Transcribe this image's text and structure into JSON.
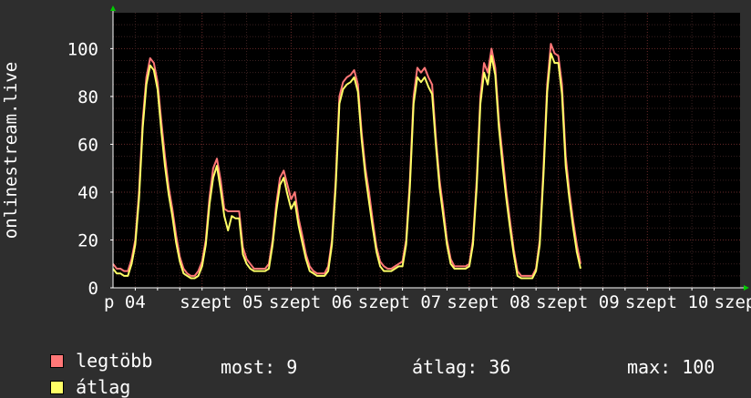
{
  "chart_data": {
    "type": "line",
    "ylabel": "onlinestream.live",
    "ylim": [
      0,
      115
    ],
    "y_ticks": [
      0,
      20,
      40,
      60,
      80,
      100
    ],
    "x_tick_labels": [
      "p 04",
      "szept 05",
      "szept 06",
      "szept 07",
      "szept 08",
      "szept 09",
      "szept 10",
      "szep"
    ],
    "grid": true,
    "colors": {
      "background": "#2e2e2e",
      "plot_background": "#000000",
      "grid": "#5a2020",
      "axis": "#ffffff",
      "arrow": "#00cc00"
    },
    "x_hours": [
      0,
      1,
      2,
      3,
      4,
      5,
      6,
      7,
      8,
      9,
      10,
      11,
      12,
      13,
      14,
      15,
      16,
      17,
      18,
      19,
      20,
      21,
      22,
      23,
      24,
      25,
      26,
      27,
      28,
      29,
      30,
      31,
      32,
      33,
      34,
      35,
      36,
      37,
      38,
      39,
      40,
      41,
      42,
      43,
      44,
      45,
      46,
      47,
      48,
      49,
      50,
      51,
      52,
      53,
      54,
      55,
      56,
      57,
      58,
      59,
      60,
      61,
      62,
      63,
      64,
      65,
      66,
      67,
      68,
      69,
      70,
      71,
      72,
      73,
      74,
      75,
      76,
      77,
      78,
      79,
      80,
      81,
      82,
      83,
      84,
      85,
      86,
      87,
      88,
      89,
      90,
      91,
      92,
      93,
      94,
      95,
      96,
      97,
      98,
      99,
      100,
      101,
      102,
      103,
      104,
      105,
      106,
      107,
      108,
      109,
      110,
      111,
      112,
      113,
      114,
      115,
      116,
      117,
      118,
      119,
      120,
      121,
      122,
      123,
      124,
      125,
      126,
      127,
      128,
      129,
      130,
      131,
      132,
      133,
      134,
      135,
      136,
      137,
      138,
      139,
      140,
      141,
      142,
      143,
      144,
      145,
      146,
      147,
      148,
      149,
      150,
      151,
      152,
      153,
      154,
      155,
      156,
      157,
      158,
      159,
      160,
      161,
      162,
      163,
      164,
      165,
      166,
      167,
      168
    ],
    "series": [
      {
        "name": "legtöbb",
        "color": "#ff7777",
        "values": [
          10,
          8,
          8,
          7,
          7,
          12,
          20,
          40,
          70,
          88,
          96,
          94,
          86,
          70,
          55,
          42,
          33,
          22,
          13,
          8,
          6,
          5,
          5,
          7,
          11,
          20,
          38,
          50,
          54,
          45,
          33,
          32,
          32,
          32,
          32,
          17,
          12,
          10,
          8,
          8,
          8,
          8,
          10,
          20,
          35,
          46,
          49,
          43,
          37,
          40,
          29,
          22,
          14,
          9,
          7,
          6,
          6,
          6,
          9,
          20,
          45,
          80,
          86,
          88,
          89,
          91,
          85,
          65,
          50,
          40,
          28,
          17,
          11,
          9,
          8,
          8,
          9,
          10,
          11,
          20,
          45,
          80,
          92,
          90,
          92,
          88,
          85,
          63,
          45,
          33,
          20,
          12,
          9,
          9,
          9,
          9,
          10,
          20,
          45,
          80,
          94,
          90,
          100,
          92,
          70,
          55,
          40,
          28,
          16,
          7,
          5,
          5,
          5,
          5,
          8,
          20,
          50,
          85,
          102,
          98,
          97,
          85,
          55,
          40,
          28,
          18,
          10
        ],
        "stat_label": "legtöbb"
      },
      {
        "name": "átlag",
        "color": "#ffff66",
        "values": [
          8,
          6,
          6,
          5,
          5,
          10,
          18,
          37,
          67,
          85,
          93,
          91,
          83,
          66,
          51,
          39,
          30,
          19,
          11,
          6,
          5,
          4,
          4,
          5,
          9,
          18,
          35,
          46,
          51,
          41,
          30,
          24,
          30,
          29,
          29,
          14,
          10,
          8,
          7,
          7,
          7,
          7,
          8,
          18,
          32,
          43,
          46,
          39,
          33,
          36,
          26,
          19,
          12,
          7,
          6,
          5,
          5,
          5,
          7,
          18,
          42,
          77,
          83,
          85,
          86,
          88,
          82,
          62,
          47,
          36,
          25,
          15,
          9,
          7,
          7,
          7,
          8,
          9,
          9,
          18,
          42,
          77,
          88,
          86,
          88,
          84,
          81,
          60,
          42,
          30,
          18,
          10,
          8,
          8,
          8,
          8,
          9,
          18,
          42,
          77,
          90,
          85,
          97,
          89,
          67,
          51,
          37,
          25,
          14,
          5,
          4,
          4,
          4,
          4,
          7,
          18,
          47,
          82,
          98,
          94,
          94,
          81,
          51,
          37,
          25,
          15,
          8
        ]
      }
    ],
    "legend": {
      "position": "bottom-left",
      "items": [
        "legtöbb",
        "átlag"
      ]
    },
    "stats": {
      "most": "most: 9",
      "atlag": "átlag: 36",
      "max": "max: 100"
    }
  }
}
